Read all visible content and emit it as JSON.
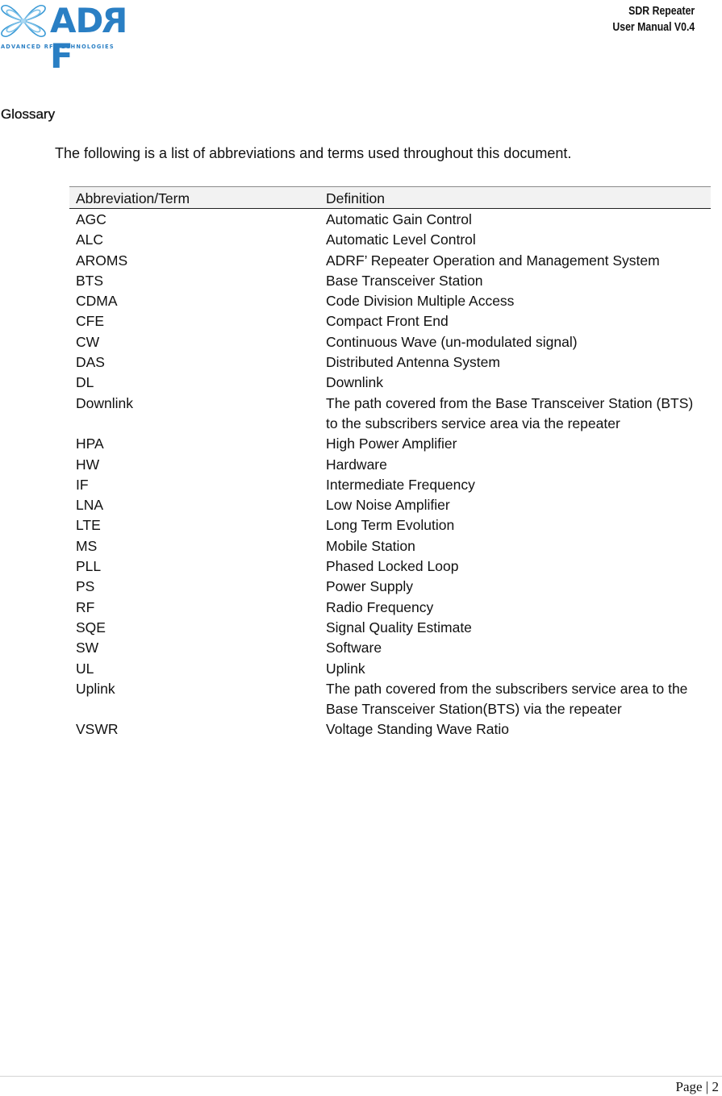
{
  "header": {
    "logo_text": "ADRF",
    "logo_tagline": "ADVANCED RF TECHNOLOGIES",
    "product": "SDR Repeater",
    "manual": "User Manual V0.4"
  },
  "section": {
    "title": "Glossary",
    "intro": "The following is a list of abbreviations and terms used throughout this document."
  },
  "table": {
    "headers": [
      "Abbreviation/Term",
      "Definition"
    ],
    "rows": [
      {
        "term": "AGC",
        "definition": "Automatic Gain Control"
      },
      {
        "term": "ALC",
        "definition": "Automatic Level Control"
      },
      {
        "term": "AROMS",
        "definition": "ADRF’ Repeater Operation and Management System"
      },
      {
        "term": "BTS",
        "definition": "Base Transceiver Station"
      },
      {
        "term": "CDMA",
        "definition": "Code Division Multiple Access"
      },
      {
        "term": "CFE",
        "definition": "Compact Front End"
      },
      {
        "term": "CW",
        "definition": "Continuous Wave (un-modulated signal)"
      },
      {
        "term": "DAS",
        "definition": "Distributed Antenna System"
      },
      {
        "term": "DL",
        "definition": "Downlink"
      },
      {
        "term": "Downlink",
        "definition": "The path covered from the Base Transceiver Station (BTS) to the subscribers service area via the repeater"
      },
      {
        "term": "HPA",
        "definition": "High Power Amplifier"
      },
      {
        "term": "HW",
        "definition": "Hardware"
      },
      {
        "term": "IF",
        "definition": "Intermediate Frequency"
      },
      {
        "term": "LNA",
        "definition": "Low Noise Amplifier"
      },
      {
        "term": "LTE",
        "definition": "Long Term Evolution"
      },
      {
        "term": "MS",
        "definition": "Mobile Station"
      },
      {
        "term": "PLL",
        "definition": "Phased Locked Loop"
      },
      {
        "term": "PS",
        "definition": "Power Supply"
      },
      {
        "term": "RF",
        "definition": "Radio Frequency"
      },
      {
        "term": "SQE",
        "definition": "Signal Quality Estimate"
      },
      {
        "term": "SW",
        "definition": "Software"
      },
      {
        "term": "UL",
        "definition": "Uplink"
      },
      {
        "term": "Uplink",
        "definition": "The path covered from the subscribers service area to the Base Transceiver Station(BTS) via the repeater"
      },
      {
        "term": "VSWR",
        "definition": "Voltage Standing Wave Ratio"
      }
    ]
  },
  "footer": {
    "page_label": "Page | 2"
  },
  "colors": {
    "brand": "#2a7fc4",
    "header_row_bg": "#f2f2f2"
  }
}
